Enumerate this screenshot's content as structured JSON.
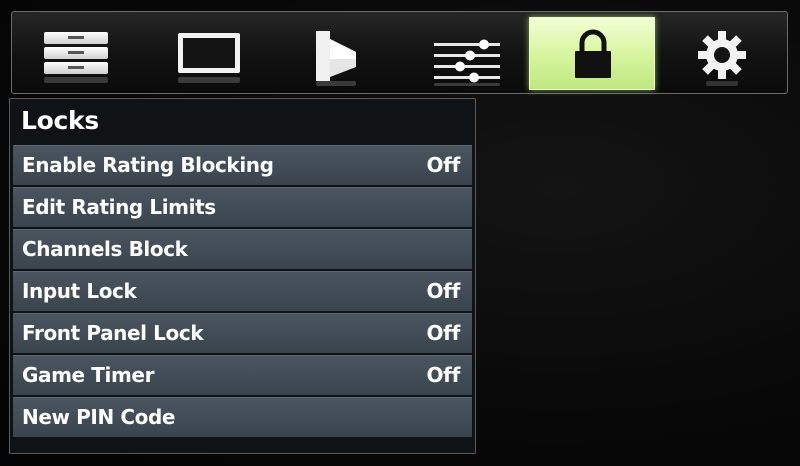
{
  "tabs": [
    {
      "icon": "picture-menu-icon",
      "active": false
    },
    {
      "icon": "display-icon",
      "active": false
    },
    {
      "icon": "speaker-icon",
      "active": false
    },
    {
      "icon": "sliders-icon",
      "active": false
    },
    {
      "icon": "lock-icon",
      "active": true
    },
    {
      "icon": "gear-icon",
      "active": false
    }
  ],
  "panel": {
    "title": "Locks",
    "items": [
      {
        "label": "Enable Rating Blocking",
        "value": "Off"
      },
      {
        "label": "Edit Rating Limits",
        "value": ""
      },
      {
        "label": "Channels Block",
        "value": ""
      },
      {
        "label": "Input Lock",
        "value": "Off"
      },
      {
        "label": "Front Panel Lock",
        "value": "Off"
      },
      {
        "label": "Game Timer",
        "value": "Off"
      },
      {
        "label": "New PIN Code",
        "value": ""
      }
    ]
  },
  "colors": {
    "active_tab": "#d8f5a0",
    "menu_row": "#444e58",
    "text": "#ffffff"
  }
}
